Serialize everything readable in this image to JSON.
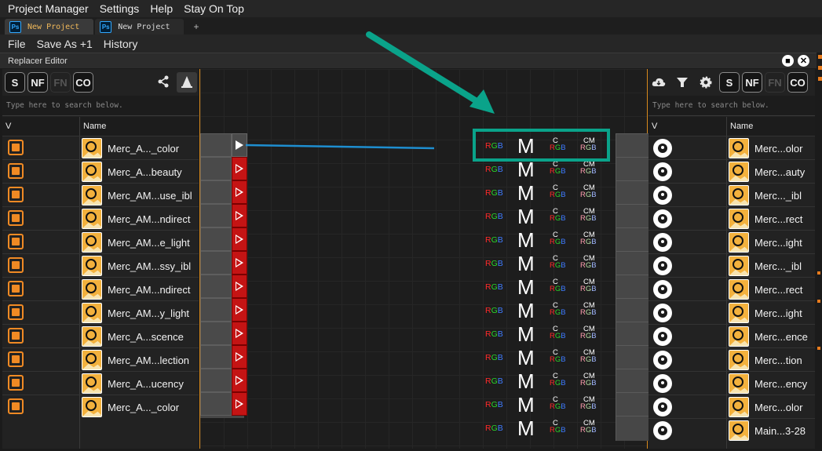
{
  "menubar": {
    "items": [
      "Project Manager",
      "Settings",
      "Help",
      "Stay On Top"
    ]
  },
  "tabs": [
    {
      "label": "New Project",
      "active": true,
      "icon": "ps-icon"
    },
    {
      "label": "New Project",
      "active": false,
      "icon": "ps-icon"
    }
  ],
  "tab_add": "+",
  "secondary_menu": {
    "items": [
      "File",
      "Save As +1",
      "History"
    ]
  },
  "editor": {
    "title": "Replacer Editor"
  },
  "left_panel": {
    "toolbar": [
      "S",
      "NF",
      "FN",
      "CO"
    ],
    "search_placeholder": "Type here to search below.",
    "col_v": "V",
    "col_name": "Name",
    "rows": [
      "Merc_A..._color",
      "Merc_A...beauty",
      "Merc_AM...use_ibl",
      "Merc_AM...ndirect",
      "Merc_AM...e_light",
      "Merc_AM...ssy_ibl",
      "Merc_AM...ndirect",
      "Merc_AM...y_light",
      "Merc_A...scence",
      "Merc_AM...lection",
      "Merc_A...ucency",
      "Merc_A..._color"
    ]
  },
  "graph": {
    "rgb_label": [
      "R",
      "G",
      "B"
    ],
    "m_label": "M",
    "c_label": "C",
    "cm_label": "CM",
    "colors": {
      "highlight": "#0aa38a",
      "wire": "#1e8ed0",
      "play_red": "#c41414",
      "accent_orange": "#f08a24"
    }
  },
  "right_panel": {
    "toolbar": [
      "S",
      "NF",
      "FN",
      "CO"
    ],
    "icons": [
      "cloud-icon",
      "filter-icon",
      "gear-icon"
    ],
    "search_placeholder": "Type here to search below.",
    "col_v": "V",
    "col_name": "Name",
    "rows": [
      "Merc...olor",
      "Merc...auty",
      "Merc..._ibl",
      "Merc...rect",
      "Merc...ight",
      "Merc..._ibl",
      "Merc...rect",
      "Merc...ight",
      "Merc...ence",
      "Merc...tion",
      "Merc...ency",
      "Merc...olor",
      "Main...3-28"
    ]
  }
}
